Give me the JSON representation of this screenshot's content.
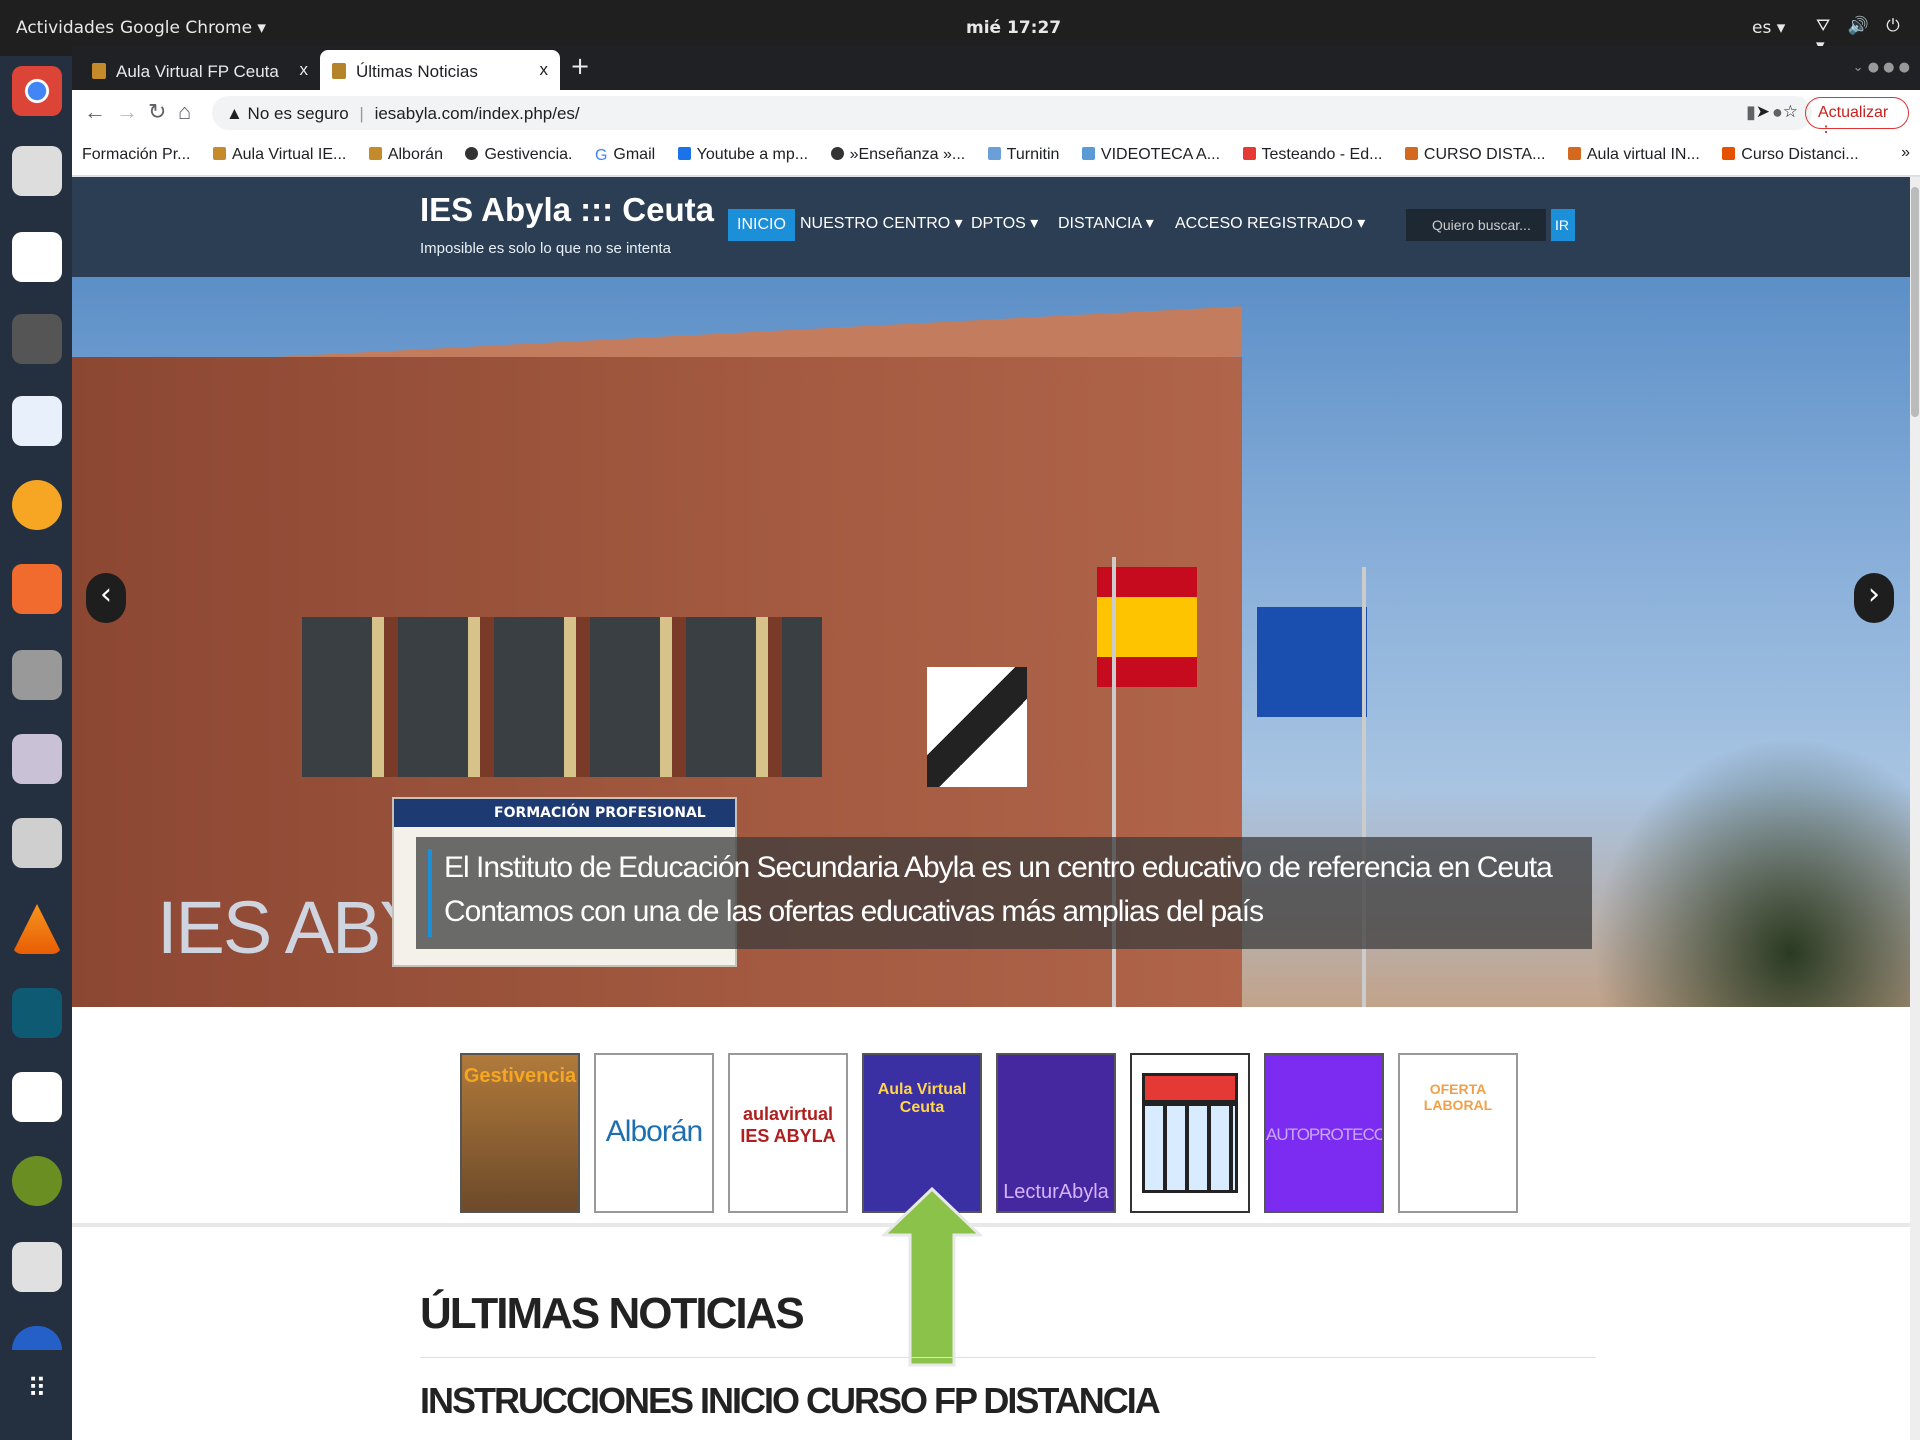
{
  "system": {
    "activities": "Actividades",
    "app": "Google Chrome ▾",
    "clock": "mié 17:27",
    "lang": "es ▾",
    "tray": "⛛ 🔊 ⏻ ▾"
  },
  "tabs": [
    {
      "title": "Aula Virtual FP Ceuta"
    },
    {
      "title": "Últimas Noticias"
    }
  ],
  "tab_close": "x",
  "omnibox": {
    "warning": "▲ No es seguro",
    "separator": "|",
    "url": "iesabyla.com/index.php/es/"
  },
  "update_button": "Actualizar  ⋮",
  "bookmarks": [
    "Formación Pr...",
    "Aula Virtual IE...",
    "Alborán",
    "Gestivencia.",
    "Gmail",
    "Youtube a mp...",
    "»Enseñanza »...",
    "Turnitin",
    "VIDEOTECA A...",
    "Testeando - Ed...",
    "CURSO DISTA...",
    "Aula virtual IN...",
    "Curso Distanci..."
  ],
  "bookmarks_more": "»",
  "site": {
    "brand": "IES Abyla ::: Ceuta",
    "tagline": "Imposible es solo lo que no se intenta",
    "nav": [
      "INICIO",
      "NUESTRO CENTRO ▾",
      "DPTOS ▾",
      "DISTANCIA ▾",
      "ACCESO REGISTRADO ▾"
    ],
    "search_placeholder": "Quiero buscar...",
    "search_button": "IR",
    "hero_sign": "IES ABYLA",
    "hero_banner": "FORMACIÓN PROFESIONAL",
    "caption_line1": "El Instituto de Educación Secundaria Abyla es un centro educativo de referencia en Ceuta",
    "caption_line2": "Contamos con una de las ofertas educativas más amplias del país",
    "thumbs": [
      "Gestivencia",
      "Alborán",
      "aulavirtual IES ABYLA",
      "Aula Virtual Ceuta",
      "LecturAbyla",
      "calendario",
      "AUTOPROTECCIÓN",
      "OFERTA LABORAL"
    ],
    "news_heading": "ÚLTIMAS NOTICIAS",
    "news_item": "INSTRUCCIONES INICIO CURSO FP DISTANCIA"
  },
  "colors": {
    "nav": "#2b3e54",
    "accent": "#1c8fd9",
    "arrow": "#8bc34a"
  }
}
